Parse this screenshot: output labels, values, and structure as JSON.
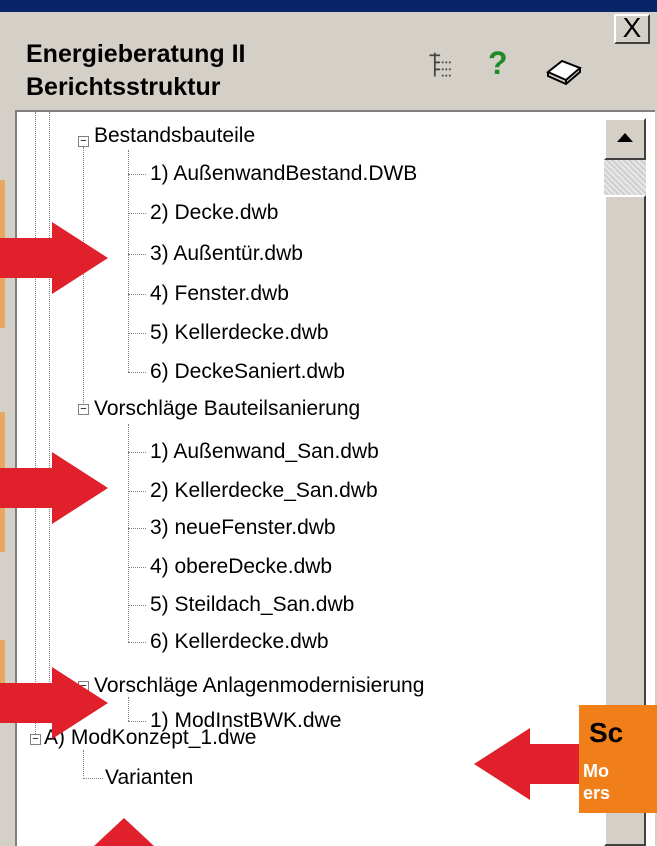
{
  "window": {
    "close_glyph": "X",
    "title_line1": "Energieberatung II",
    "title_line2": "Berichtsstruktur"
  },
  "toolbar": {
    "tree_icon": "tree-structure-icon",
    "help_label": "?",
    "help_color": "#1e8a28",
    "book_icon": "book-icon"
  },
  "tree": {
    "groups": [
      {
        "label": "Bestandsbauteile",
        "items": [
          "1) AußenwandBestand.DWB",
          "2) Decke.dwb",
          "3) Außentür.dwb",
          "4) Fenster.dwb",
          "5) Kellerdecke.dwb",
          "6) DeckeSaniert.dwb"
        ]
      },
      {
        "label": "Vorschläge Bauteilsanierung",
        "items": [
          "1) Außenwand_San.dwb",
          "2) Kellerdecke_San.dwb",
          "3) neueFenster.dwb",
          "4) obereDecke.dwb",
          "5) Steildach_San.dwb",
          "6) Kellerdecke.dwb"
        ]
      },
      {
        "label": "Vorschläge Anlagenmodernisierung",
        "items": [
          "1) ModInstBWK.dwe"
        ]
      }
    ],
    "root2": {
      "label": "A) ModKonzept_1.dwe",
      "child": "Varianten"
    }
  },
  "callout": {
    "line1": "Sc",
    "line2": "Mo",
    "line3": "ers",
    "color": "#f07f1a"
  },
  "colors": {
    "titlebar": "#0a246a",
    "arrow": "#e0202a"
  }
}
